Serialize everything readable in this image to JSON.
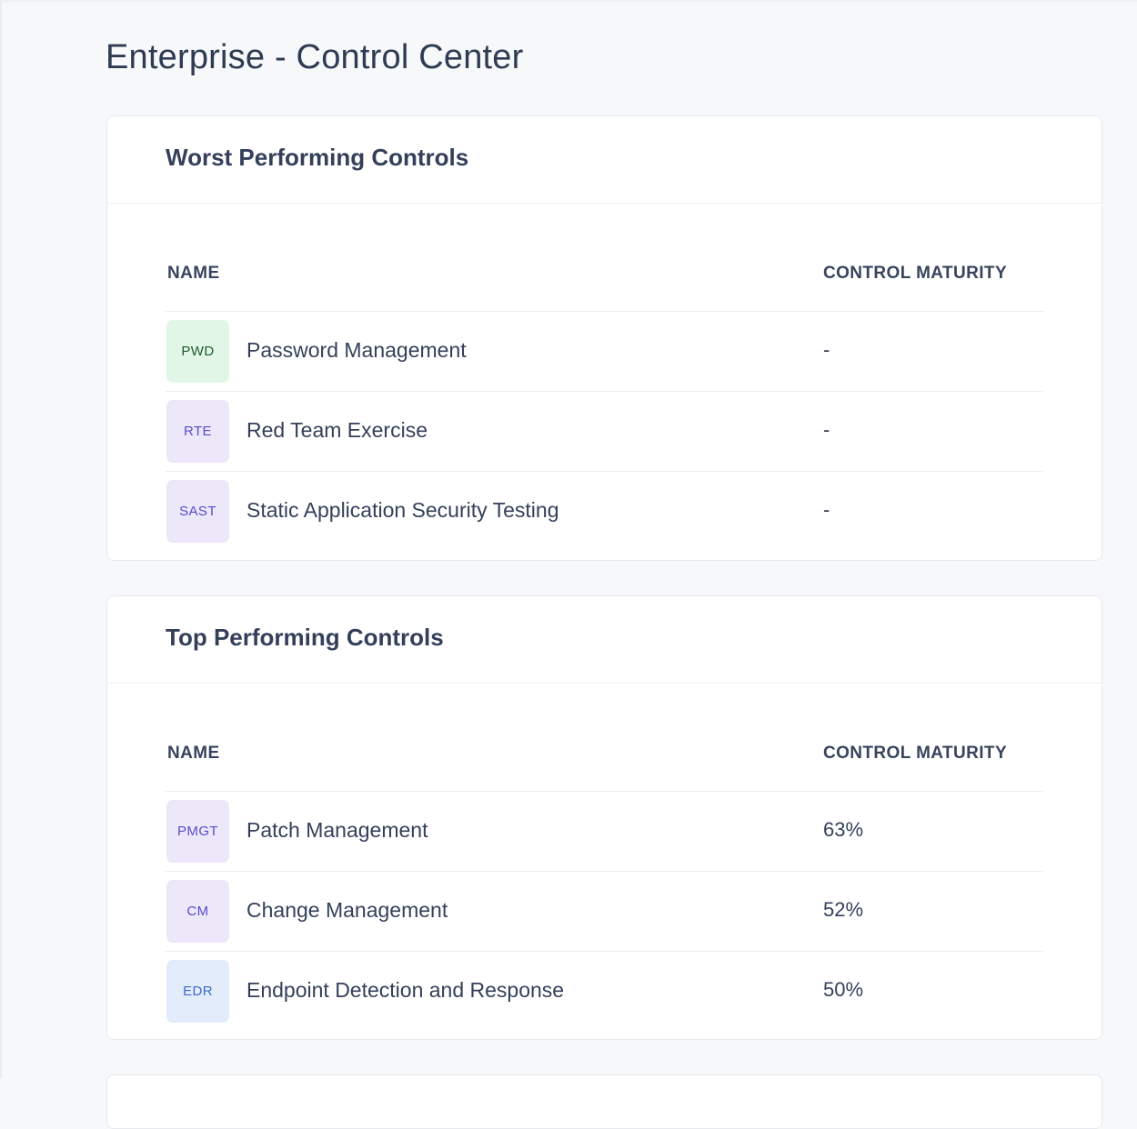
{
  "page": {
    "title": "Enterprise - Control Center"
  },
  "worst_controls": {
    "title": "Worst Performing Controls",
    "columns": [
      "NAME",
      "CONTROL MATURITY"
    ],
    "rows": [
      {
        "abbr": "PWD",
        "name": "Password Management",
        "maturity": "-",
        "badge_color": "#e2f6e8"
      },
      {
        "abbr": "RTE",
        "name": "Red Team Exercise",
        "maturity": "-",
        "badge_color": "#ede7fa"
      },
      {
        "abbr": "SAST",
        "name": "Static Application Security Testing",
        "maturity": "-",
        "badge_color": "#ede7fa"
      }
    ]
  },
  "top_controls": {
    "title": "Top Performing Controls",
    "columns": [
      "NAME",
      "CONTROL MATURITY"
    ],
    "rows": [
      {
        "abbr": "PMGT",
        "name": "Patch Management",
        "maturity": "63%",
        "badge_color": "#ede7fa"
      },
      {
        "abbr": "CM",
        "name": "Change Management",
        "maturity": "52%",
        "badge_color": "#ede7fa"
      },
      {
        "abbr": "EDR",
        "name": "Endpoint Detection and Response",
        "maturity": "50%",
        "badge_color": "#e3ecfb"
      }
    ]
  }
}
